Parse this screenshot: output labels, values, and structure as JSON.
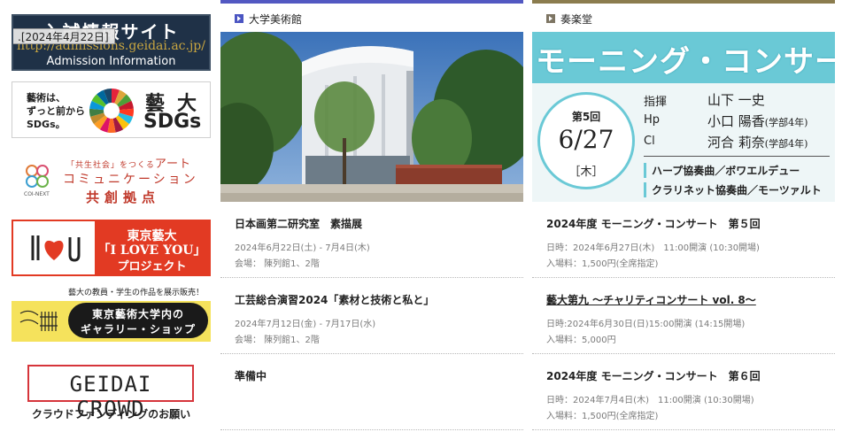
{
  "sidebar": {
    "admission": {
      "title": "入試情報サイト",
      "url": "http://admissions.geidai.ac.jp/",
      "subtitle": "Admission Information",
      "date_tooltip": ".[2024年4月22日]"
    },
    "sdgs": {
      "text_lines": [
        "藝術は、",
        "ずっと前から",
        "SDGs。"
      ],
      "kanji": "藝大",
      "word": "SDGs"
    },
    "coi": {
      "caption": "COI-NEXT",
      "line1_small": "「共生社会」をつくる",
      "line1": "アート",
      "line2": "コミュニケーション",
      "line3": "共創拠点"
    },
    "iloveyou": {
      "line1": "東京藝大",
      "line2": "「I LOVE YOU」",
      "line3": "プロジェクト"
    },
    "gallery": {
      "top_text": "藝大の教員・学生の作品を展示販売！",
      "line1": "東京藝術大学内の",
      "line2": "ギャラリー・ショップ"
    },
    "crowd": {
      "word": "GEIDAI CROWD",
      "subtitle": "クラウドファンディングのお願い"
    }
  },
  "museum": {
    "venue": "大学美術館",
    "events": [
      {
        "title": "日本画第二研究室　素描展",
        "date": "2024年6月22日(土) - 7月4日(木)",
        "place": "会場： 陳列館1、2階",
        "link": false
      },
      {
        "title": "工芸総合演習2024「素材と技術と私と」",
        "date": "2024年7月12日(金) - 7月17日(水)",
        "place": "会場： 陳列館1、2階",
        "link": false
      },
      {
        "title": "準備中",
        "date": "",
        "place": "",
        "link": false
      }
    ]
  },
  "hall": {
    "venue": "奏楽堂",
    "poster": {
      "title": "モーニング・コンサート",
      "number": "第5回",
      "date": "6/27",
      "weekday": "［木］",
      "performers": [
        {
          "role": "指揮",
          "name": "山下 一史",
          "note": ""
        },
        {
          "role": "Hp",
          "name": "小口 陽香",
          "note": "(学部4年)"
        },
        {
          "role": "Cl",
          "name": "河合 莉奈",
          "note": "(学部4年)"
        }
      ],
      "program": [
        "ハープ協奏曲／ボワエルデュー",
        "クラリネット協奏曲／モーツァルト"
      ]
    },
    "events": [
      {
        "title": "2024年度 モーニング・コンサート　第５回",
        "date": "日時：2024年6月27日(木)　11:00開演 (10:30開場)",
        "place": "入場料：1,500円(全席指定)",
        "link": false
      },
      {
        "title": "藝大第九 〜チャリティコンサート vol. 8〜",
        "date": "日時:2024年6月30日(日)15:00開演 (14:15開場)",
        "place": "入場料：5,000円",
        "link": true
      },
      {
        "title": "2024年度 モーニング・コンサート　第６回",
        "date": "日時：2024年7月4日(木)　11:00開演 (10:30開場)",
        "place": "入場料：1,500円(全席指定)",
        "link": false
      }
    ]
  },
  "colors": {
    "museum_accent": "#5258c2",
    "hall_accent": "#8b7c4e",
    "poster_cyan": "#6ac9d6",
    "crowd_red": "#d6353b",
    "iloveyou_red": "#e23a23",
    "gallery_yellow": "#f5e25c",
    "admission_navy": "#1f3147"
  }
}
